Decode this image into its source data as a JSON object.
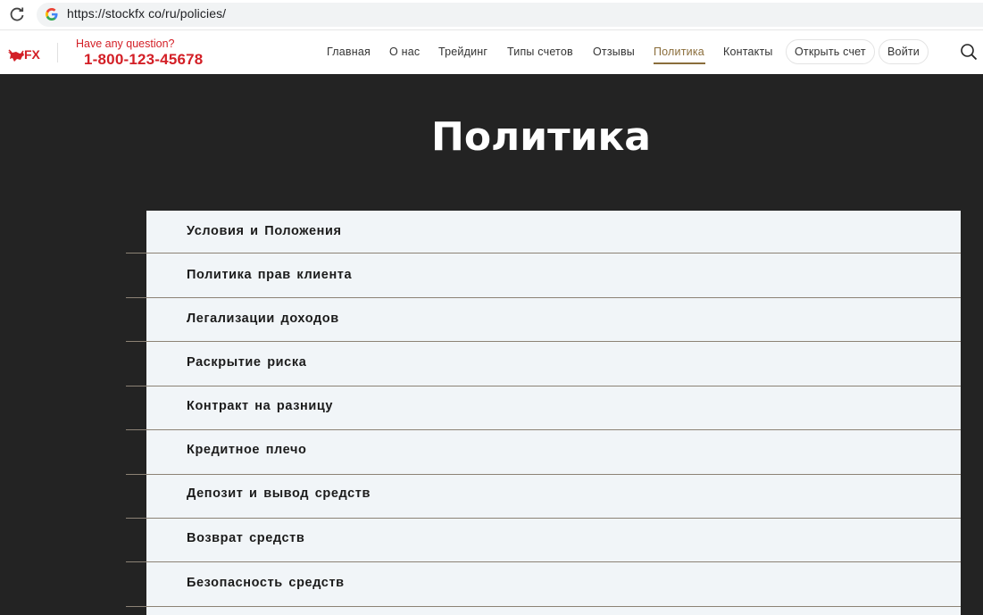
{
  "browser": {
    "url": "https://stockfx co/ru/policies/"
  },
  "header": {
    "logo_text": "FX",
    "question": "Have any question?",
    "phone": "1-800-123-45678",
    "nav": [
      {
        "label": "Главная"
      },
      {
        "label": "О нас"
      },
      {
        "label": "Трейдинг"
      },
      {
        "label": "Типы счетов"
      },
      {
        "label": "Отзывы"
      },
      {
        "label": "Политика",
        "active": true
      },
      {
        "label": "Контакты"
      }
    ],
    "open_account": "Открыть счет",
    "login": "Войти"
  },
  "page": {
    "title": "Политика"
  },
  "policies": [
    {
      "label": "Условия  и  Положения"
    },
    {
      "label": "Политика  прав  клиента"
    },
    {
      "label": "Легализации  доходов"
    },
    {
      "label": "Раскрытие  риска"
    },
    {
      "label": "Контракт  на  разницу"
    },
    {
      "label": "Кредитное  плечо"
    },
    {
      "label": "Депозит  и  вывод  средств"
    },
    {
      "label": "Возврат  средств"
    },
    {
      "label": "Безопасность  средств"
    }
  ],
  "colors": {
    "brand_red": "#d31f26",
    "active_nav": "#8a6d3b",
    "hero_bg": "#232323",
    "list_bg": "#f1f5f8"
  }
}
